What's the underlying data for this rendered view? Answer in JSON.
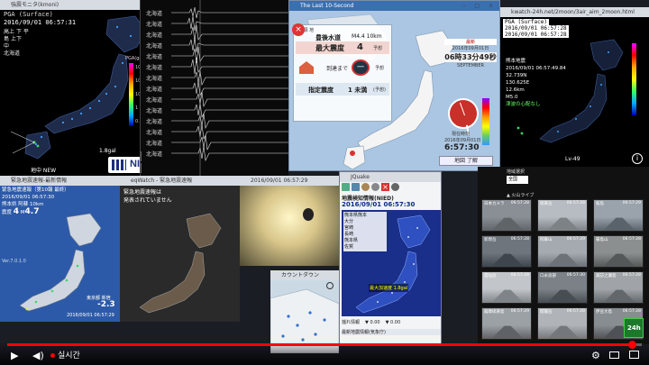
{
  "kyoshin": {
    "title_tab": "強震モニタ(kmoni)",
    "pga_label": "PGA (Surface)",
    "datetime": "2016/09/01 06:57:31",
    "rows": [
      {
        "a": "高上",
        "b": "下 平"
      },
      {
        "a": "島",
        "b": "上下"
      },
      {
        "a": "中",
        "b": ""
      },
      {
        "a": "北海道",
        "b": ""
      }
    ],
    "scale_label": "PGA(gal)",
    "scale_values": [
      "1000",
      "100",
      "10",
      "1",
      "0.1"
    ],
    "footer_label": "地中 NEW",
    "logo": "NIED",
    "corner_value": "1.8gal"
  },
  "waveform": {
    "stations": [
      "北海道",
      "北海道",
      "北海道",
      "北海道",
      "北海道",
      "北海道",
      "北海道",
      "北海道",
      "北海道",
      "北海道",
      "北海道",
      "北海道",
      "北海道",
      "北海道"
    ],
    "buttons": [
      "設定",
      "履歴"
    ]
  },
  "weathernews": {
    "title_tab": "The Last 10-Second",
    "brand": "weathernews",
    "header_right": "最新",
    "title_row": "震  源  地",
    "location": "豊後水道",
    "magnitude_label": "M",
    "magnitude_value": "4.4",
    "depth": "10km",
    "max_int_label": "最大震度",
    "max_int_value": "4",
    "expected_label": "予想",
    "arrival_label": "到達まで",
    "arrival_value": "一",
    "expected2": "予想",
    "designated_label": "指定震度",
    "designated_value": "1 未満",
    "designated_suffix": "(予想)",
    "date": "2016年09月01日",
    "time_big": "06時33分49秒",
    "month_day": "SEPTEMBER",
    "clock_time": "6:57:30",
    "clock_caption": "現在時刻",
    "clock_date": "2016年09月01日",
    "footer_button": "地図 了解"
  },
  "kwatch": {
    "url": "kwatch-24h.net/2moon/3air_aim_2moon.html",
    "pga_label": "PGA (Surface)",
    "datetime1": "2016/09/01 06:57:28",
    "datetime2": "2016/09/01 06:57:28",
    "quake_label": "熊本地震",
    "quake_time": "2016/09/01 06:57:49.84",
    "lat": "32.739N",
    "lon": "130.625E",
    "depth": "12.6km",
    "mag": "M5.0",
    "tsunami": "津波の心配なし",
    "corner": "Lv-49"
  },
  "eew": {
    "title_tab": "緊急地震速報-最新情報",
    "row1": "緊急地震速報（第10報 最終）",
    "row2": "2016/09/01 06:57:30",
    "origin": "熊本県 阿蘇",
    "mag_label": "M",
    "mag_value": "4.7",
    "depth": "10km",
    "int_label": "震度",
    "int_value": "4",
    "version": "Ver.7.0.1.0",
    "place_label": "東京都 新宿",
    "big_value": "-2.3",
    "time": "2016/09/01 06:57:29"
  },
  "eew2": {
    "title_tab": "eqWatch - 緊急地震速報",
    "message1": "緊急地震速報は",
    "message2": "発表されていません"
  },
  "camera_small": {
    "title": "2016/09/01 06:57:29"
  },
  "mini_map": {
    "title": "カウントダウン"
  },
  "jquake": {
    "title_tab": "JQuake",
    "info_title": "地震検知情報(NIED)",
    "time": "2016/09/01 06:57:30",
    "rows": [
      "熊本県熊本",
      "大分",
      "宮崎",
      "長崎",
      "熊本県",
      "佐賀"
    ],
    "scale_text": "最大加速度 1.8gal",
    "footer_left": "揺れ情報",
    "footer_val1": "▼ 0.00",
    "footer_val2": "▼ 0.00",
    "bottom_title": "最新地震情報(気象庁)"
  },
  "cameras": {
    "header1": "地域選択",
    "header2": "地図",
    "select_value": "全国",
    "caption": "▲ 火山ライブ",
    "tiles": [
      {
        "name": "日本カメラ",
        "time": "06:57:28"
      },
      {
        "name": "硫黄岳",
        "time": "06:57:28"
      },
      {
        "name": "桜島",
        "time": "06:57:29"
      },
      {
        "name": "新燃岳",
        "time": "06:57:28"
      },
      {
        "name": "阿蘇山",
        "time": "06:57:29"
      },
      {
        "name": "霧島山",
        "time": "06:57:28"
      },
      {
        "name": "雲仙岳",
        "time": "06:57:28"
      },
      {
        "name": "口永良部",
        "time": "06:57:30"
      },
      {
        "name": "諏訪之瀬島",
        "time": "06:57:28"
      },
      {
        "name": "薩摩硫黄島",
        "time": "06:57:29"
      },
      {
        "name": "開聞岳",
        "time": "06:57:28"
      },
      {
        "name": "伊豆大島",
        "time": "06:57:28"
      },
      {
        "name": "三宅島",
        "time": "06:57:29"
      },
      {
        "name": "浅間山",
        "time": "06:57:28"
      },
      {
        "name": "草津白根",
        "time": "06:57:28"
      }
    ],
    "badge": "24h"
  },
  "player": {
    "progress": 0.985,
    "live_label": "실시간",
    "icons": [
      "play-icon",
      "volume-icon",
      "settings-icon",
      "miniplayer-icon",
      "theater-icon",
      "fullscreen-icon"
    ]
  }
}
